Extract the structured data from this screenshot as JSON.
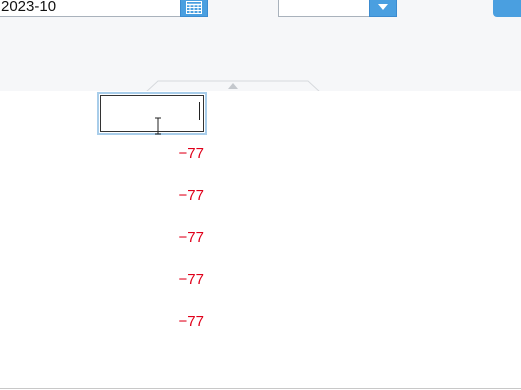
{
  "toolbar": {
    "date_value": "2023-10",
    "select_value": "",
    "action_label": "",
    "calendar_icon": "calendar-icon",
    "dropdown_icon": "chevron-down-icon",
    "collapse_icon": "collapse-up-icon"
  },
  "grid": {
    "editing_value": "",
    "rows": [
      {
        "value": "−77"
      },
      {
        "value": "−77"
      },
      {
        "value": "−77"
      },
      {
        "value": "−77"
      },
      {
        "value": "−77"
      }
    ]
  },
  "colors": {
    "accent": "#4a9fe0",
    "negative": "#e0001a",
    "toolbar_bg": "#f6f7f9",
    "focus_border": "#a8cdea"
  }
}
